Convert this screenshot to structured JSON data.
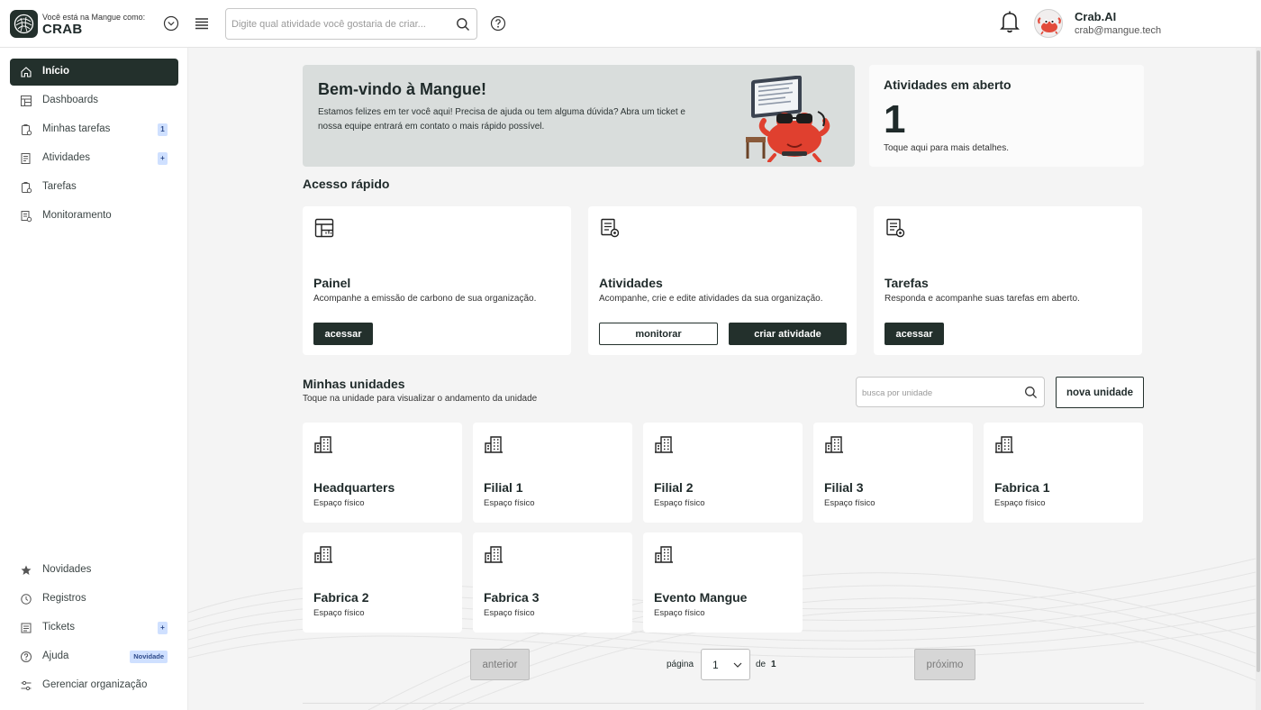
{
  "header": {
    "org_caption": "Você está na Mangue como:",
    "org_name": "CRAB",
    "search_placeholder": "Digite qual atividade você gostaria de criar...",
    "user_name": "Crab.AI",
    "user_email": "crab@mangue.tech"
  },
  "sidebar": {
    "items": [
      {
        "label": "Início",
        "icon": "home-icon",
        "active": true
      },
      {
        "label": "Dashboards",
        "icon": "dashboard-icon"
      },
      {
        "label": "Minhas tarefas",
        "icon": "clipboard-icon",
        "badge": "1"
      },
      {
        "label": "Atividades",
        "icon": "activity-list-icon",
        "badge": "+"
      },
      {
        "label": "Tarefas",
        "icon": "clipboard-icon"
      },
      {
        "label": "Monitoramento",
        "icon": "monitor-doc-icon"
      }
    ],
    "bottom_items": [
      {
        "label": "Novidades",
        "icon": "star-icon"
      },
      {
        "label": "Registros",
        "icon": "history-icon"
      },
      {
        "label": "Tickets",
        "icon": "ticket-icon",
        "badge": "+"
      },
      {
        "label": "Ajuda",
        "icon": "help-icon",
        "badge": "Novidade"
      },
      {
        "label": "Gerenciar organização",
        "icon": "sliders-icon"
      }
    ]
  },
  "welcome": {
    "title": "Bem-vindo à Mangue!",
    "text": "Estamos felizes em ter você aqui! Precisa de ajuda ou tem alguma dúvida? Abra um ticket e nossa equipe entrará em contato o mais rápido possível."
  },
  "open_activities": {
    "title": "Atividades em aberto",
    "count": "1",
    "subtitle": "Toque aqui para mais detalhes."
  },
  "quick_access": {
    "title": "Acesso rápido",
    "cards": [
      {
        "title": "Painel",
        "desc": "Acompanhe a emissão de carbono de sua organização.",
        "buttons": [
          "acessar"
        ]
      },
      {
        "title": "Atividades",
        "desc": "Acompanhe, crie e edite atividades da sua organização.",
        "buttons": [
          "monitorar",
          "criar atividade"
        ]
      },
      {
        "title": "Tarefas",
        "desc": "Responda e acompanhe suas tarefas em aberto.",
        "buttons": [
          "acessar"
        ]
      }
    ]
  },
  "units": {
    "title": "Minhas unidades",
    "subtitle": "Toque na unidade para visualizar o andamento da unidade",
    "search_placeholder": "busca por unidade",
    "new_button": "nova unidade",
    "items": [
      {
        "name": "Headquarters",
        "type": "Espaço físico"
      },
      {
        "name": "Filial 1",
        "type": "Espaço físico"
      },
      {
        "name": "Filial 2",
        "type": "Espaço físico"
      },
      {
        "name": "Filial 3",
        "type": "Espaço físico"
      },
      {
        "name": "Fabrica 1",
        "type": "Espaço físico"
      },
      {
        "name": "Fabrica 2",
        "type": "Espaço físico"
      },
      {
        "name": "Fabrica 3",
        "type": "Espaço físico"
      },
      {
        "name": "Evento Mangue",
        "type": "Espaço físico"
      }
    ]
  },
  "pagination": {
    "prev": "anterior",
    "next": "próximo",
    "page_label": "página",
    "page_value": "1",
    "of_label": "de",
    "total": "1"
  },
  "colors": {
    "brand_dark": "#23302c",
    "badge_bg": "#cfe0ff",
    "welcome_bg": "#d9dddc",
    "page_bg": "#f4f4f4"
  }
}
